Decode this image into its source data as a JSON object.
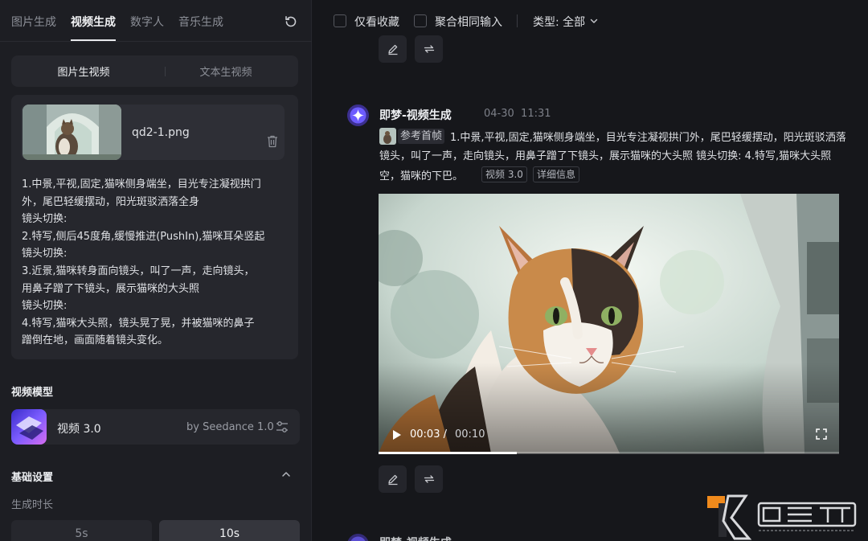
{
  "nav": {
    "tabs": [
      "图片生成",
      "视频生成",
      "数字人",
      "音乐生成"
    ],
    "active_tab": "视频生成"
  },
  "mode": {
    "options": [
      "图片生视频",
      "文本生视频"
    ],
    "active": "图片生视频"
  },
  "upload": {
    "file_name": "qd2-1.png"
  },
  "prompt_lines": [
    "1.中景,平视,固定,猫咪侧身端坐，目光专注凝视拱门",
    "外，尾巴轻缓摆动，阳光斑驳洒落全身",
    "镜头切换:",
    "2.特写,侧后45度角,缓慢推进(PushIn),猫咪耳朵竖起",
    "镜头切换:",
    "3.近景,猫咪转身面向镜头，叫了一声，走向镜头，",
    "用鼻子蹭了下镜头，展示猫咪的大头照",
    "镜头切换:",
    "4.特写,猫咪大头照，镜头晃了晃，并被猫咪的鼻子",
    "蹭倒在地，画面随着镜头变化。"
  ],
  "model": {
    "section_title": "视频模型",
    "name": "视频 3.0",
    "by": "by Seedance 1.0"
  },
  "basic": {
    "section_title": "基础设置",
    "duration_label": "生成时长",
    "durations": [
      "5s",
      "10s"
    ],
    "selected_duration": "10s"
  },
  "filters": {
    "favorites_only": "仅看收藏",
    "merge_same_input": "聚合相同输入",
    "type_label": "类型: 全部"
  },
  "entry": {
    "title": "即梦-视频生成",
    "date": "04-30",
    "time": "11:31",
    "ref_label": "参考首帧",
    "desc_lines": [
      "1.中景,平视,固定,猫咪侧身端坐，目光专注凝视拱门外，尾巴轻缓摆动，阳光斑驳洒落",
      "镜头，叫了一声，走向镜头，用鼻子蹭了下镜头，展示猫咪的大头照 镜头切换: 4.特写,猫咪大头照",
      "空，猫咪的下巴。"
    ],
    "tags": [
      "视频 3.0",
      "详细信息"
    ],
    "video": {
      "current": "00:03",
      "sep": "/",
      "total": "00:10",
      "progress_fraction": 0.3
    }
  },
  "next_entry_title": "即梦-视频生成",
  "icons": {
    "refresh": "refresh-icon",
    "trash": "trash-icon",
    "sliders": "sliders-icon",
    "chevron_up": "chevron-up-icon",
    "chevron_down": "chevron-down-icon",
    "edit": "edit-icon",
    "regenerate": "regenerate-icon",
    "play": "play-icon",
    "fullscreen": "fullscreen-icon",
    "avatar": "sparkle-icon"
  },
  "colors": {
    "accent_purple": "#6d5cff",
    "panel_bg": "#1d1e23",
    "main_bg": "#16171b",
    "watermark_orange": "#f08a1c"
  }
}
